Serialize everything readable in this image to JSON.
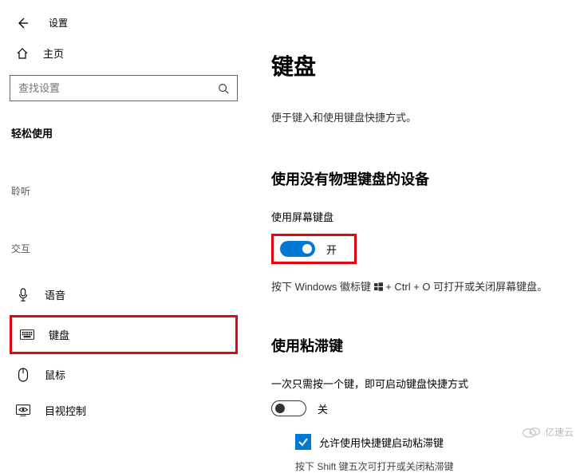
{
  "header": {
    "title": "设置"
  },
  "sidebar": {
    "home": "主页",
    "search_placeholder": "查找设置",
    "section": "轻松使用",
    "sub1": "聆听",
    "sub2": "交互",
    "items": {
      "voice": "语音",
      "keyboard": "键盘",
      "mouse": "鼠标",
      "eye": "目视控制"
    }
  },
  "content": {
    "title": "键盘",
    "desc": "便于键入和使用键盘快捷方式。",
    "s1_title": "使用没有物理键盘的设备",
    "s1_label": "使用屏幕键盘",
    "s1_toggle": "开",
    "s1_hint_a": "按下 Windows 徽标键 ",
    "s1_hint_b": " + Ctrl + O 可打开或关闭屏幕键盘。",
    "s2_title": "使用粘滞键",
    "s2_label": "一次只需按一个键，即可启动键盘快捷方式",
    "s2_toggle": "关",
    "s2_check": "允许使用快捷键启动粘滞键",
    "s2_hint": "按下 Shift 键五次可打开或关闭粘滞键"
  },
  "watermark": "亿速云"
}
